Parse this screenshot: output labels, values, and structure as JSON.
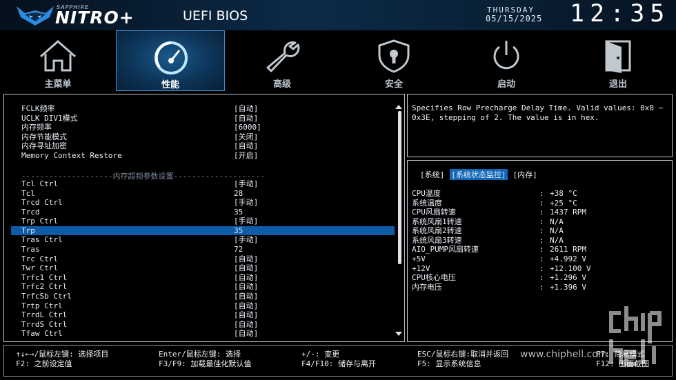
{
  "header": {
    "brand_small": "SAPPHIRE",
    "brand": "NITRO+",
    "title": "UEFI BIOS",
    "weekday": "THURSDAY",
    "date": "05/15/2025",
    "time": "12:35"
  },
  "tabs": [
    {
      "label": "主菜单",
      "icon": "home-icon"
    },
    {
      "label": "性能",
      "icon": "speedometer-icon"
    },
    {
      "label": "高级",
      "icon": "wrench-icon"
    },
    {
      "label": "安全",
      "icon": "shield-lock-icon"
    },
    {
      "label": "启动",
      "icon": "power-icon"
    },
    {
      "label": "退出",
      "icon": "exit-door-icon"
    }
  ],
  "settings_top": [
    {
      "label": "FCLK频率",
      "value": "[自动]"
    },
    {
      "label": "UCLK DIV1模式",
      "value": "[自动]"
    },
    {
      "label": "内存频率",
      "value": "[6000]"
    },
    {
      "label": "内存节能模式",
      "value": "[关闭]"
    },
    {
      "label": "内存寻址加密",
      "value": "[自动]"
    },
    {
      "label": "Memory Context Restore",
      "value": "[开启]"
    }
  ],
  "separator": "--------------------内存超频参数设置--------------------",
  "settings_timing": [
    {
      "label": "Tcl Ctrl",
      "value": "[手动]"
    },
    {
      "label": "Tcl",
      "value": "28"
    },
    {
      "label": "Trcd Ctrl",
      "value": "[手动]"
    },
    {
      "label": "Trcd",
      "value": "35"
    },
    {
      "label": "Trp Ctrl",
      "value": "[手动]"
    },
    {
      "label": "Trp",
      "value": "35"
    },
    {
      "label": "Tras Ctrl",
      "value": "[手动]"
    },
    {
      "label": "Tras",
      "value": "72"
    },
    {
      "label": "Trc Ctrl",
      "value": "[自动]"
    },
    {
      "label": "Twr Ctrl",
      "value": "[自动]"
    },
    {
      "label": "Trfc1 Ctrl",
      "value": "[自动]"
    },
    {
      "label": "Trfc2 Ctrl",
      "value": "[自动]"
    },
    {
      "label": "TrfcSb Ctrl",
      "value": "[自动]"
    },
    {
      "label": "Trtp Ctrl",
      "value": "[自动]"
    },
    {
      "label": "TrrdL Ctrl",
      "value": "[自动]"
    },
    {
      "label": "TrrdS Ctrl",
      "value": "[自动]"
    },
    {
      "label": "Tfaw Ctrl",
      "value": "[自动]"
    }
  ],
  "help": {
    "text": "Specifies Row Precharge Delay Time. Valid values: 0x8 ~ 0x3E, stepping of 2. The value is in hex."
  },
  "monitor": {
    "tabs": [
      "[系统]",
      "[系统状态监控]",
      "[内存]"
    ],
    "rows": [
      {
        "label": "CPU温度",
        "value": "+38 °C"
      },
      {
        "label": "系统温度",
        "value": "+25 °C"
      },
      {
        "label": "CPU风扇转速",
        "value": "1437 RPM"
      },
      {
        "label": "系统风扇1转速",
        "value": "N/A"
      },
      {
        "label": "系统风扇2转速",
        "value": "N/A"
      },
      {
        "label": "系统风扇3转速",
        "value": "N/A"
      },
      {
        "label": "AIO_PUMP风扇转速",
        "value": "2611 RPM"
      },
      {
        "label": "+5V",
        "value": "+4.992 V"
      },
      {
        "label": "+12V",
        "value": "+12.100 V"
      },
      {
        "label": "CPU核心电压",
        "value": "+1.296 V"
      },
      {
        "label": "内存电压",
        "value": "+1.396 V"
      }
    ]
  },
  "footer": {
    "k1": "↑↓←→/鼠标左键: 选择项目",
    "k2": "F2: 之前设定值",
    "k3": "Enter/鼠标左键: 选择",
    "k4": "F3/F9: 加载最佳化默认值",
    "k5": "+/-: 变更",
    "k6": "F4/F10: 储存与离开",
    "k7": "ESC/鼠标右键:取消并返回",
    "k8": "F5: 显示系统信息",
    "k9": "F7: 简易模式",
    "k10": "F12: 画面截图"
  },
  "watermark": "www.chiphell.com"
}
